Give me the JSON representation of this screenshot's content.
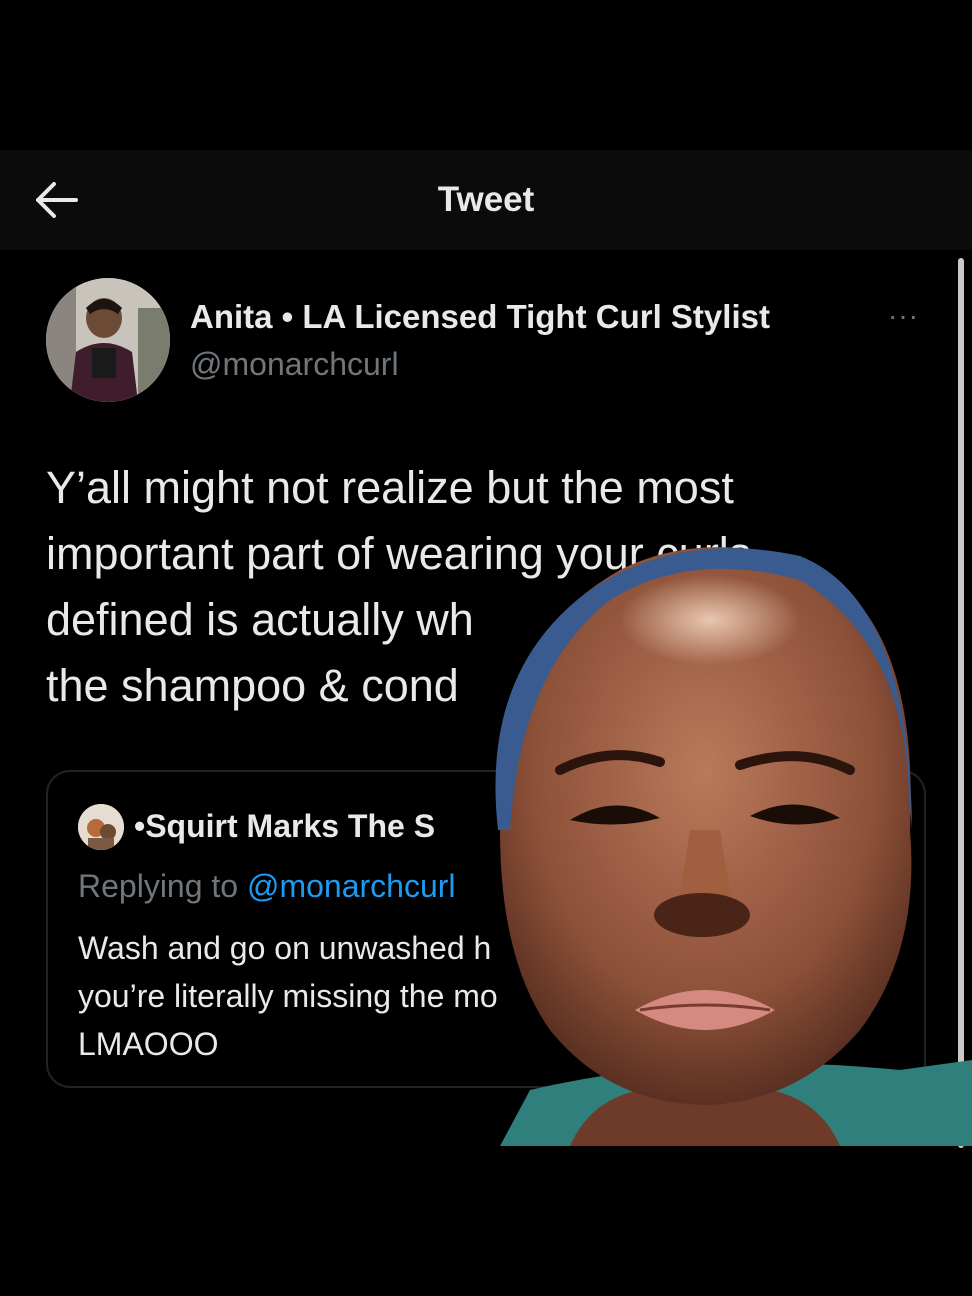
{
  "header": {
    "title": "Tweet"
  },
  "tweet": {
    "author_name": "Anita • LA Licensed Tight Curl Stylist",
    "author_handle": "@monarchcurl",
    "more_label": "···",
    "body_lines": [
      "Y’all might not realize but the most",
      "important part of wearing your curls",
      "defined is actually wh",
      "the shampoo & cond"
    ]
  },
  "quote": {
    "author_name": "•Squirt Marks The S",
    "replying_prefix": "Replying to ",
    "replying_handle": "@monarchcurl",
    "text_lines": [
      "Wash and go on unwashed h",
      "you’re literally missing the mo",
      "LMAOOO"
    ]
  },
  "icons": {
    "back": "arrow-left-icon",
    "more": "more-dots-icon"
  },
  "colors": {
    "background": "#000000",
    "text_primary": "#e7e9ea",
    "text_secondary": "#71767b",
    "link": "#1d9bf0"
  }
}
